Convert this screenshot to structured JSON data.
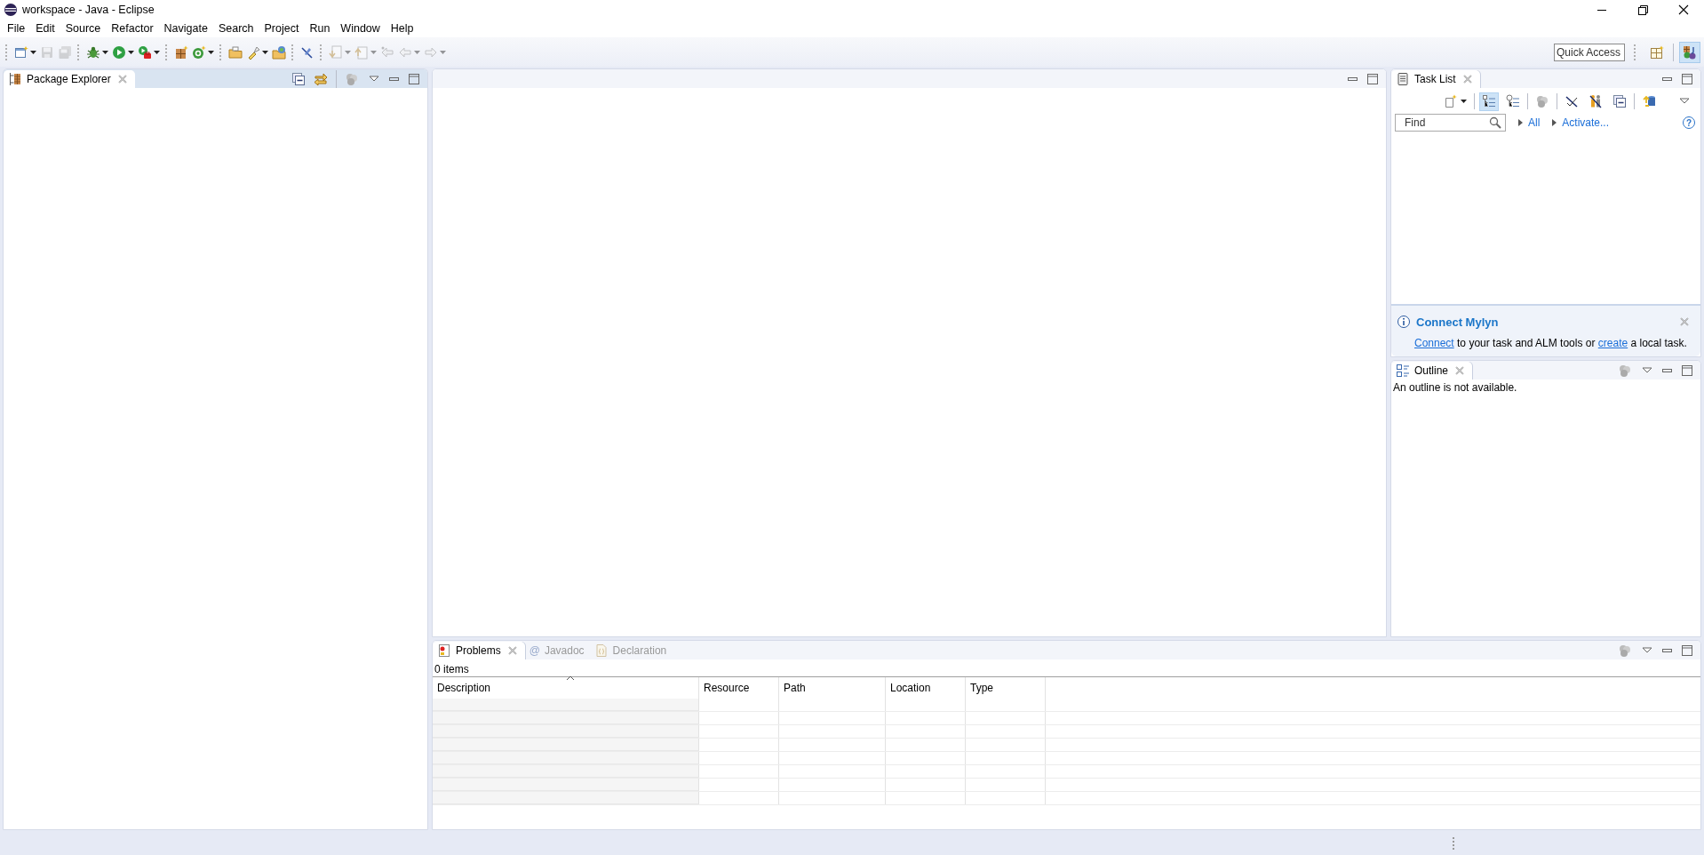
{
  "window": {
    "title": "workspace - Java - Eclipse"
  },
  "menu": [
    "File",
    "Edit",
    "Source",
    "Refactor",
    "Navigate",
    "Search",
    "Project",
    "Run",
    "Window",
    "Help"
  ],
  "toolbar": [
    [
      {
        "disabled": false,
        "dropdown": true
      },
      {
        "disabled": true,
        "dropdown": false
      },
      {
        "disabled": true,
        "dropdown": false
      }
    ],
    [
      {
        "disabled": false,
        "dropdown": true
      },
      {
        "disabled": false,
        "dropdown": true
      },
      {
        "disabled": false,
        "dropdown": true
      }
    ],
    [
      {
        "disabled": false,
        "dropdown": false
      },
      {
        "disabled": false,
        "dropdown": true
      }
    ],
    [
      {
        "disabled": false,
        "dropdown": false
      },
      {
        "disabled": false,
        "dropdown": true
      },
      {
        "disabled": false,
        "dropdown": false
      }
    ],
    [
      {
        "disabled": false,
        "dropdown": false
      }
    ],
    [
      {
        "disabled": true,
        "dropdown": true
      },
      {
        "disabled": true,
        "dropdown": true
      },
      {
        "disabled": true,
        "dropdown": false
      },
      {
        "disabled": true,
        "dropdown": true
      },
      {
        "disabled": true,
        "dropdown": true
      }
    ]
  ],
  "quick_access": {
    "placeholder": "Quick Access"
  },
  "perspectives": [
    {
      "selected": false
    },
    {
      "selected": true
    }
  ],
  "package_explorer": {
    "active": true,
    "tabs": [
      {
        "label": "Package Explorer",
        "selected": true,
        "closable": true
      }
    ]
  },
  "task_list": {
    "active": false,
    "tabs": [
      {
        "label": "Task List",
        "selected": true,
        "closable": true
      }
    ],
    "toolbar": [
      {
        "selected": false,
        "dropdown": true
      },
      {
        "selected": true,
        "dropdown": false
      },
      {
        "selected": false,
        "dropdown": false
      },
      {
        "selected": false,
        "dropdown": false
      },
      {
        "selected": false,
        "dropdown": false
      },
      {
        "selected": false,
        "dropdown": false
      },
      {
        "selected": false,
        "dropdown": false
      },
      {
        "selected": false,
        "dropdown": false
      }
    ],
    "find": {
      "placeholder": "Find"
    },
    "links": [
      "All",
      "Activate..."
    ],
    "help": "?",
    "notification": {
      "title": "Connect Mylyn",
      "message": [
        {
          "text": "Connect",
          "link": true
        },
        {
          "text": " to your task and ALM tools or ",
          "link": false
        },
        {
          "text": "create",
          "link": true
        },
        {
          "text": " a local task.",
          "link": false
        }
      ]
    }
  },
  "outline": {
    "active": false,
    "tabs": [
      {
        "label": "Outline",
        "selected": true,
        "closable": true
      }
    ],
    "message": "An outline is not available."
  },
  "problems": {
    "active": false,
    "tabs": [
      {
        "label": "Problems",
        "selected": true,
        "closable": true
      },
      {
        "label": "Javadoc",
        "selected": false,
        "closable": false,
        "glyph": "@"
      },
      {
        "label": "Declaration",
        "selected": false,
        "closable": false
      }
    ],
    "summary": "0 items",
    "columns": [
      {
        "label": "Description",
        "sorted": true
      },
      {
        "label": "Resource",
        "sorted": false
      },
      {
        "label": "Path",
        "sorted": false
      },
      {
        "label": "Location",
        "sorted": false
      },
      {
        "label": "Type",
        "sorted": false
      }
    ]
  }
}
